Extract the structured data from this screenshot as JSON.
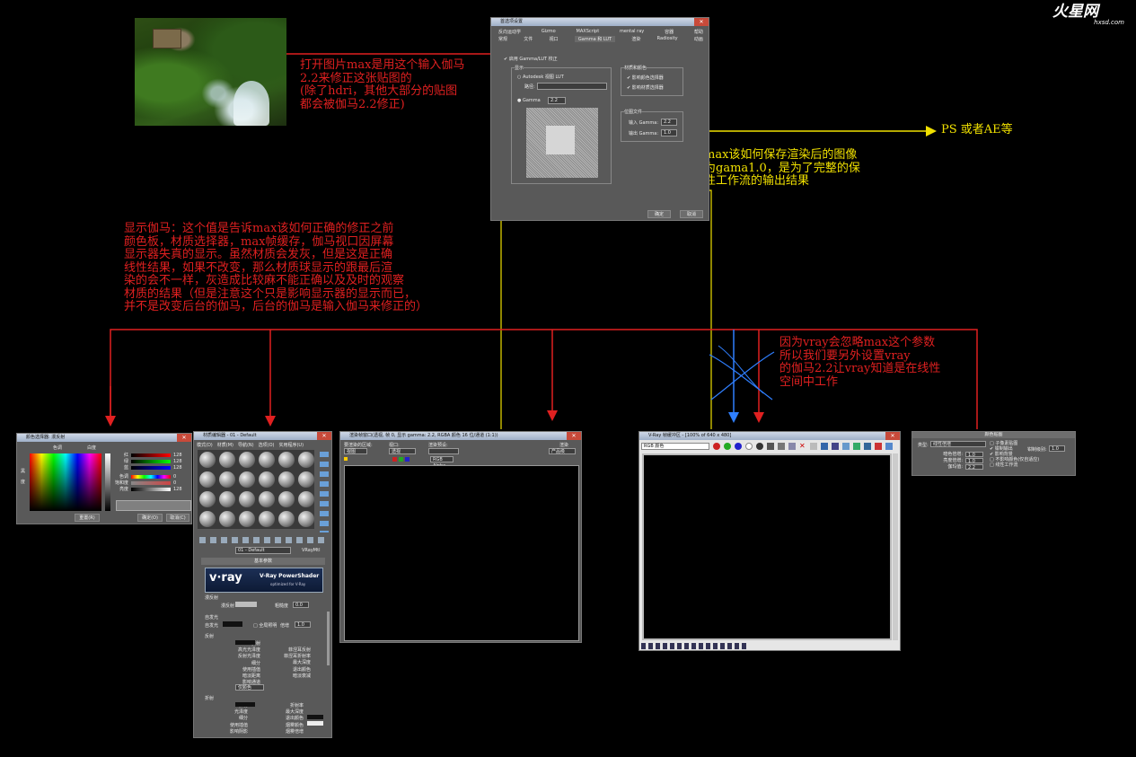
{
  "logo": {
    "text": "火星网",
    "sub": "hxsd.com"
  },
  "annotations": {
    "top_red": "打开图片max是用这个输入伽马\n2.2来修正这张贴图的\n(除了hdri，其他大部分的贴图\n都会被伽马2.2修正)",
    "right_yellow": "告诉max该如何保存渲染后的图像\n保存为gama1.0，是为了完整的保\n存线性工作流的输出结果",
    "ps_label": "PS 或者AE等",
    "mid_red": "显示伽马：这个值是告诉max该如何正确的修正之前\n颜色板，材质选择器，max帧缓存，伽马视口因屏幕\n显示器失真的显示。虽然材质会发灰，但是这是正确\n线性结果，如果不改变，那么材质球显示的跟最后渲\n染的会不一样，灰造成比较麻不能正确以及及时的观察\n材质的结果（但是注意这个只是影响显示器的显示而已，\n并不是改变后台的伽马，后台的伽马是输入伽马来修正的）",
    "vray_red": "因为vray会忽略max这个参数\n所以我们要另外设置vray\n的伽马2.2让vray知道是在线性\n空间中工作"
  },
  "prefs": {
    "title": "首选项设置",
    "tabs_row1": [
      "反向运动学",
      "Gizmo",
      "MAXScript",
      "mental ray",
      "容器",
      "帮助"
    ],
    "tabs_row2": [
      "常规",
      "文件",
      "视口",
      "Gamma 和 LUT",
      "渲染",
      "Radiosity",
      "动画"
    ],
    "enable": "启用 Gamma/LUT 校正",
    "display_group": "显示",
    "autodesk_lut": "Autodesk 视图 LUT",
    "path_label": "路径:",
    "gamma_label": "Gamma",
    "gamma_value": "2.2",
    "materials_group": "材质和颜色",
    "affect_color": "影响颜色选择器",
    "affect_material": "影响材质选择器",
    "bitmap_group": "位图文件",
    "input_gamma": "输入 Gamma:",
    "input_value": "2.2",
    "output_gamma": "输出 Gamma:",
    "output_value": "1.0",
    "ok": "确定",
    "cancel": "取消"
  },
  "color_selector": {
    "title": "颜色选择器: 漫反射",
    "hue": "色调",
    "white": "白度",
    "black": "黑",
    "degree": "度",
    "labels": [
      "红",
      "绿",
      "蓝",
      "色调",
      "饱和度",
      "亮度"
    ],
    "values": [
      "128",
      "128",
      "128",
      "0",
      "0",
      "128"
    ],
    "reset": "重置(R)",
    "ok": "确定(O)",
    "cancel": "取消(C)"
  },
  "material_editor": {
    "title": "材质编辑器 - 01 - Default",
    "menu": [
      "模式(D)",
      "材质(M)",
      "导航(N)",
      "选项(O)",
      "实用程序(U)"
    ],
    "mat_name": "01 - Default",
    "mat_type": "VRayMtl",
    "rollout": "基本参数",
    "vray_logo": "v·ray",
    "vray_title": "V-Ray PowerShader",
    "vray_sub": "optimized for V-Ray",
    "diffuse_group": "漫反射",
    "diffuse": "漫反射",
    "roughness": "粗糙度",
    "rough_val": "0.0",
    "selfillum_group": "自发光",
    "selfillum": "自发光",
    "gi": "全局照明",
    "mult": "倍增",
    "mult_val": "1.0",
    "reflect_group": "反射",
    "reflect_rows": [
      "反射",
      "高光光泽度",
      "反射光泽度",
      "细分",
      "使用插值",
      "暗淡距离",
      "影响通道"
    ],
    "reflect_right": [
      "菲涅耳反射",
      "菲涅耳折射率",
      "最大深度",
      "退出颜色",
      "暗淡衰减"
    ],
    "affect_channel": "仅颜色",
    "refract_group": "折射",
    "refract_rows": [
      "折射",
      "光泽度",
      "细分",
      "使用插值",
      "影响阴影"
    ],
    "refract_right": [
      "折射率",
      "最大深度",
      "退出颜色",
      "烟雾颜色",
      "烟雾倍增"
    ]
  },
  "frame_buffer": {
    "title": "渲染帧窗口(透视, 帧 0, 显示 gamma: 2.2, RGBA 颜色 16 位/通道 (1:1))",
    "area_label": "要渲染的区域:",
    "area_value": "视图",
    "viewport_label": "视口:",
    "viewport_value": "透视",
    "preset_label": "渲染预设:",
    "render_btn": "渲染",
    "channel": "RGB Alpha",
    "mode": "产品级"
  },
  "vfb": {
    "title": "V-Ray 帧缓冲区 - [100% of 640 x 480]",
    "channel": "RGB 颜色"
  },
  "color_mapping": {
    "title": "颜色贴图",
    "type_label": "类型:",
    "type_value": "线性倍增",
    "opts": [
      "子像素贴图",
      "钳制输出",
      "影响背景",
      "不影响颜色(仅自适应)",
      "线性工作流"
    ],
    "clamp_label": "钳制级别:",
    "clamp_val": "1.0",
    "rows": [
      "暗色倍增:",
      "亮度倍增:",
      "伽玛值:"
    ],
    "vals": [
      "1.0",
      "1.0",
      "2.2"
    ]
  },
  "colors": {
    "red": "#e02020",
    "yellow": "#f0e000",
    "blue": "#2f7fff"
  }
}
